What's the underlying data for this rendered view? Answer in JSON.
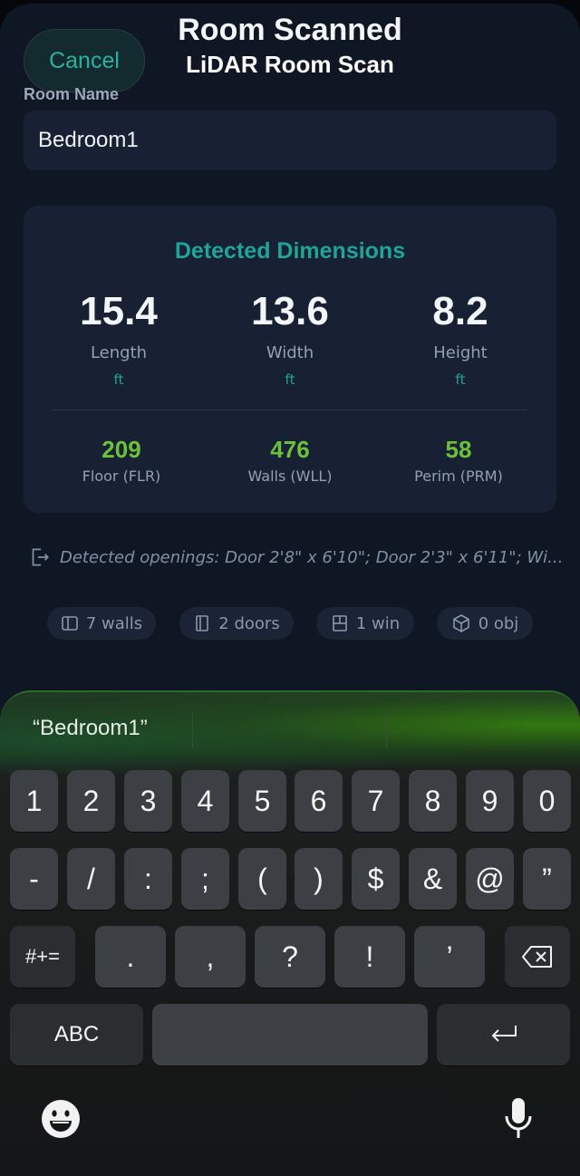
{
  "header": {
    "title": "Room Scanned",
    "subtitle": "LiDAR Room Scan",
    "cancel_label": "Cancel"
  },
  "room": {
    "label": "Room Name",
    "value": "Bedroom1"
  },
  "dimensions": {
    "title": "Detected Dimensions",
    "items": [
      {
        "value": "15.4",
        "label": "Length",
        "unit": "ft"
      },
      {
        "value": "13.6",
        "label": "Width",
        "unit": "ft"
      },
      {
        "value": "8.2",
        "label": "Height",
        "unit": "ft"
      }
    ],
    "areas": [
      {
        "value": "209",
        "label": "Floor (FLR)"
      },
      {
        "value": "476",
        "label": "Walls (WLL)"
      },
      {
        "value": "58",
        "label": "Perim (PRM)"
      }
    ]
  },
  "openings_text": "Detected openings: Door 2'8\" x 6'10\"; Door 2'3\" x 6'11\"; Wi...",
  "chips": [
    {
      "icon": "walls-icon",
      "label": "7 walls"
    },
    {
      "icon": "door-icon",
      "label": "2 doors"
    },
    {
      "icon": "window-icon",
      "label": "1 win"
    },
    {
      "icon": "cube-icon",
      "label": "0 obj"
    }
  ],
  "keyboard": {
    "suggestion": "“Bedroom1”",
    "row1": [
      "1",
      "2",
      "3",
      "4",
      "5",
      "6",
      "7",
      "8",
      "9",
      "0"
    ],
    "row2": [
      "-",
      "/",
      ":",
      ";",
      "(",
      ")",
      "$",
      "&",
      "@",
      "”"
    ],
    "row3": {
      "toggle": "#+=",
      "keys": [
        ".",
        ",",
        "?",
        "!",
        "’"
      ]
    },
    "abc_label": "ABC"
  },
  "colors": {
    "accent": "#1fa597",
    "area_green": "#6cc13a"
  }
}
